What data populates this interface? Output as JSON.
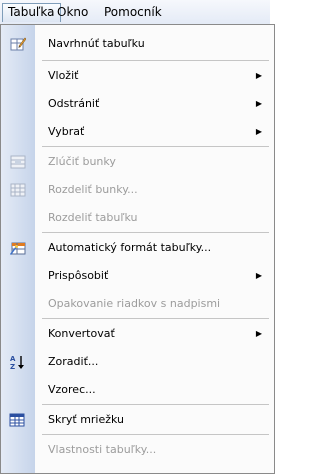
{
  "menubar": {
    "items": [
      {
        "label": "Tabuľka"
      },
      {
        "label": "Okno"
      },
      {
        "label": "Pomocník"
      }
    ]
  },
  "menu": {
    "items": [
      {
        "label": "Navrhnúť tabuľku",
        "icon": "pencil-table-icon",
        "enabled": true
      },
      {
        "label": "Vložiť",
        "icon": "",
        "enabled": true,
        "submenu": true
      },
      {
        "label": "Odstrániť",
        "icon": "",
        "enabled": true,
        "submenu": true
      },
      {
        "label": "Vybrať",
        "icon": "",
        "enabled": true,
        "submenu": true
      },
      {
        "label": "Zlúčiť bunky",
        "icon": "merge-cells-icon",
        "enabled": false
      },
      {
        "label": "Rozdeliť bunky...",
        "icon": "split-cells-icon",
        "enabled": false
      },
      {
        "label": "Rozdeliť tabuľku",
        "icon": "",
        "enabled": false
      },
      {
        "label": "Automatický formát tabuľky...",
        "icon": "autoformat-table-icon",
        "enabled": true
      },
      {
        "label": "Prispôsobiť",
        "icon": "",
        "enabled": true,
        "submenu": true
      },
      {
        "label": "Opakovanie riadkov s nadpismi",
        "icon": "",
        "enabled": false
      },
      {
        "label": "Konvertovať",
        "icon": "",
        "enabled": true,
        "submenu": true
      },
      {
        "label": "Zoradiť...",
        "icon": "sort-az-icon",
        "enabled": true
      },
      {
        "label": "Vzorec...",
        "icon": "",
        "enabled": true
      },
      {
        "label": "Skryť mriežku",
        "icon": "gridlines-icon",
        "enabled": true,
        "checked": true
      },
      {
        "label": "Vlastnosti tabuľky...",
        "icon": "",
        "enabled": false
      }
    ],
    "submenu_arrow": "▶"
  }
}
